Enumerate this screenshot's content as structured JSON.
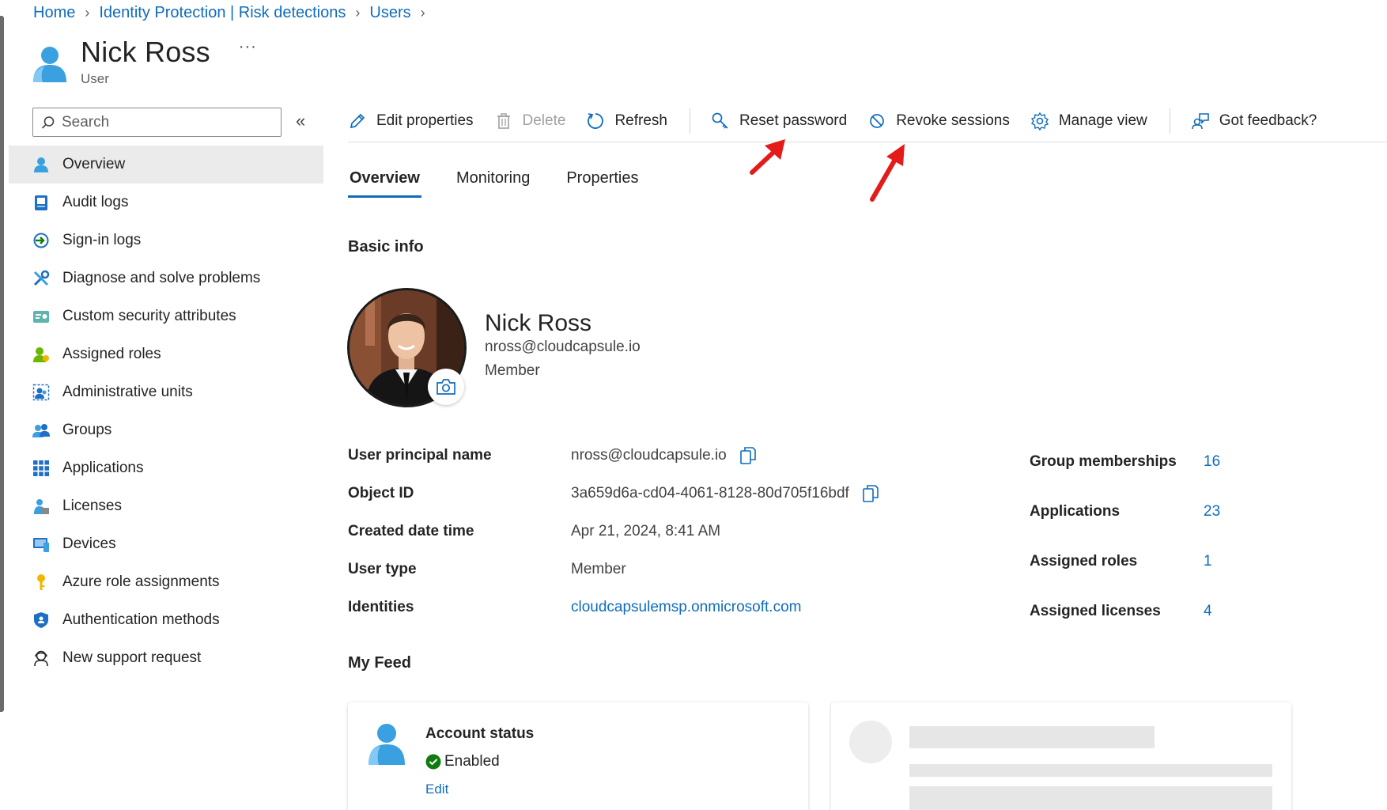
{
  "breadcrumb": {
    "items": [
      "Home",
      "Identity Protection | Risk detections",
      "Users"
    ]
  },
  "header": {
    "title": "Nick Ross",
    "subtitle": "User",
    "more": "···"
  },
  "sidebar": {
    "search_placeholder": "Search",
    "collapse": "«",
    "items": [
      {
        "label": "Overview",
        "icon": "user-icon"
      },
      {
        "label": "Audit logs",
        "icon": "audit-log-icon"
      },
      {
        "label": "Sign-in logs",
        "icon": "sign-in-icon"
      },
      {
        "label": "Diagnose and solve problems",
        "icon": "wrench-icon"
      },
      {
        "label": "Custom security attributes",
        "icon": "attributes-icon"
      },
      {
        "label": "Assigned roles",
        "icon": "roles-icon"
      },
      {
        "label": "Administrative units",
        "icon": "admin-units-icon"
      },
      {
        "label": "Groups",
        "icon": "groups-icon"
      },
      {
        "label": "Applications",
        "icon": "apps-grid-icon"
      },
      {
        "label": "Licenses",
        "icon": "licenses-icon"
      },
      {
        "label": "Devices",
        "icon": "devices-icon"
      },
      {
        "label": "Azure role assignments",
        "icon": "key-icon"
      },
      {
        "label": "Authentication methods",
        "icon": "shield-icon"
      },
      {
        "label": "New support request",
        "icon": "support-icon"
      }
    ]
  },
  "toolbar": {
    "edit": "Edit properties",
    "delete": "Delete",
    "refresh": "Refresh",
    "reset_password": "Reset password",
    "revoke_sessions": "Revoke sessions",
    "manage_view": "Manage view",
    "feedback": "Got feedback?"
  },
  "tabs": [
    "Overview",
    "Monitoring",
    "Properties"
  ],
  "basic_info": {
    "title": "Basic info",
    "name": "Nick Ross",
    "email": "nross@cloudcapsule.io",
    "user_type": "Member"
  },
  "details": {
    "upn_label": "User principal name",
    "upn": "nross@cloudcapsule.io",
    "object_id_label": "Object ID",
    "object_id": "3a659d6a-cd04-4061-8128-80d705f16bdf",
    "created_label": "Created date time",
    "created": "Apr 21, 2024, 8:41 AM",
    "user_type_label": "User type",
    "user_type": "Member",
    "identities_label": "Identities",
    "identities": "cloudcapsulemsp.onmicrosoft.com"
  },
  "stats": {
    "groups_label": "Group memberships",
    "groups": "16",
    "apps_label": "Applications",
    "apps": "23",
    "roles_label": "Assigned roles",
    "roles": "1",
    "licenses_label": "Assigned licenses",
    "licenses": "4"
  },
  "feed": {
    "title": "My Feed",
    "account_status_title": "Account status",
    "account_status": "Enabled",
    "edit": "Edit"
  },
  "colors": {
    "accent": "#0f6cbd",
    "annotation": "#e31b1b",
    "success": "#107c10"
  }
}
